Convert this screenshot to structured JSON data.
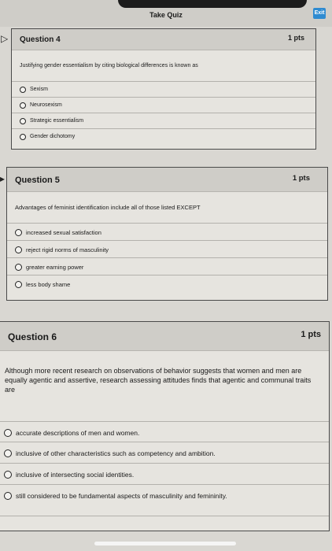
{
  "header": {
    "title": "Take Quiz",
    "exit_label": "Exit"
  },
  "questions": [
    {
      "title": "Question 4",
      "points": "1 pts",
      "text": "Justifying gender essentialism by citing biological differences is known as",
      "options": [
        "Sexism",
        "Neurosexism",
        "Strategic essentialism",
        "Gender dichotomy"
      ]
    },
    {
      "title": "Question 5",
      "points": "1 pts",
      "text": "Advantages of feminist identification include all of those listed EXCEPT",
      "options": [
        "increased sexual satisfaction",
        "reject rigid norms of masculinity",
        "greater earning power",
        "less body shame"
      ]
    },
    {
      "title": "Question 6",
      "points": "1 pts",
      "text": "Although more recent research on observations of behavior suggests that women and men are equally agentic and assertive, research assessing attitudes finds that agentic and communal traits are",
      "options": [
        "accurate descriptions of men and women.",
        "inclusive of other characteristics such as competency and ambition.",
        "inclusive of intersecting social identities.",
        "still considered to be fundamental aspects of masculinity and femininity."
      ]
    }
  ]
}
